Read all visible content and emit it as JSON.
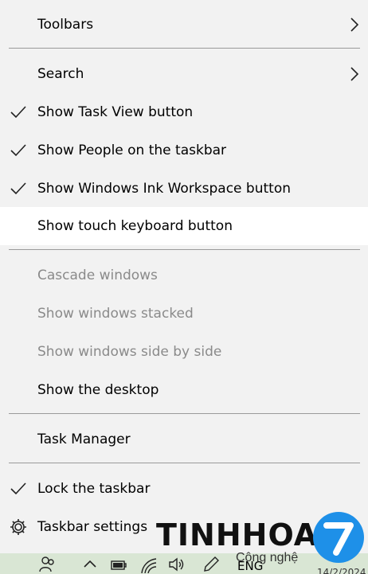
{
  "menu": {
    "items": [
      {
        "label": "Toolbars",
        "checked": false,
        "submenu": true,
        "disabled": false
      },
      {
        "label": "Search",
        "checked": false,
        "submenu": true,
        "disabled": false
      },
      {
        "label": "Show Task View button",
        "checked": true,
        "submenu": false,
        "disabled": false
      },
      {
        "label": "Show People on the taskbar",
        "checked": true,
        "submenu": false,
        "disabled": false
      },
      {
        "label": "Show Windows Ink Workspace button",
        "checked": true,
        "submenu": false,
        "disabled": false
      },
      {
        "label": "Show touch keyboard button",
        "checked": false,
        "submenu": false,
        "disabled": false,
        "highlighted": true
      },
      {
        "label": "Cascade windows",
        "checked": false,
        "submenu": false,
        "disabled": true
      },
      {
        "label": "Show windows stacked",
        "checked": false,
        "submenu": false,
        "disabled": true
      },
      {
        "label": "Show windows side by side",
        "checked": false,
        "submenu": false,
        "disabled": true
      },
      {
        "label": "Show the desktop",
        "checked": false,
        "submenu": false,
        "disabled": false
      },
      {
        "label": "Task Manager",
        "checked": false,
        "submenu": false,
        "disabled": false
      },
      {
        "label": "Lock the taskbar",
        "checked": true,
        "submenu": false,
        "disabled": false
      },
      {
        "label": "Taskbar settings",
        "checked": false,
        "submenu": false,
        "disabled": false,
        "icon": "gear-icon"
      }
    ]
  },
  "taskbar": {
    "icons": [
      "people-icon",
      "chevron-up-icon",
      "battery-icon",
      "wifi-icon",
      "volume-icon",
      "pen-icon"
    ],
    "language": "ENG",
    "clock_partial": "14/2/2024"
  },
  "watermark": {
    "brand": "TINHHOA",
    "subtitle": "Công nghệ",
    "logo_digit": "7"
  },
  "colors": {
    "menu_bg": "#f2f2f2",
    "highlight_bg": "#ffffff",
    "disabled_text": "#8a8a8a",
    "separator": "#9a9a9a",
    "logo_blue": "#1e90e8"
  }
}
